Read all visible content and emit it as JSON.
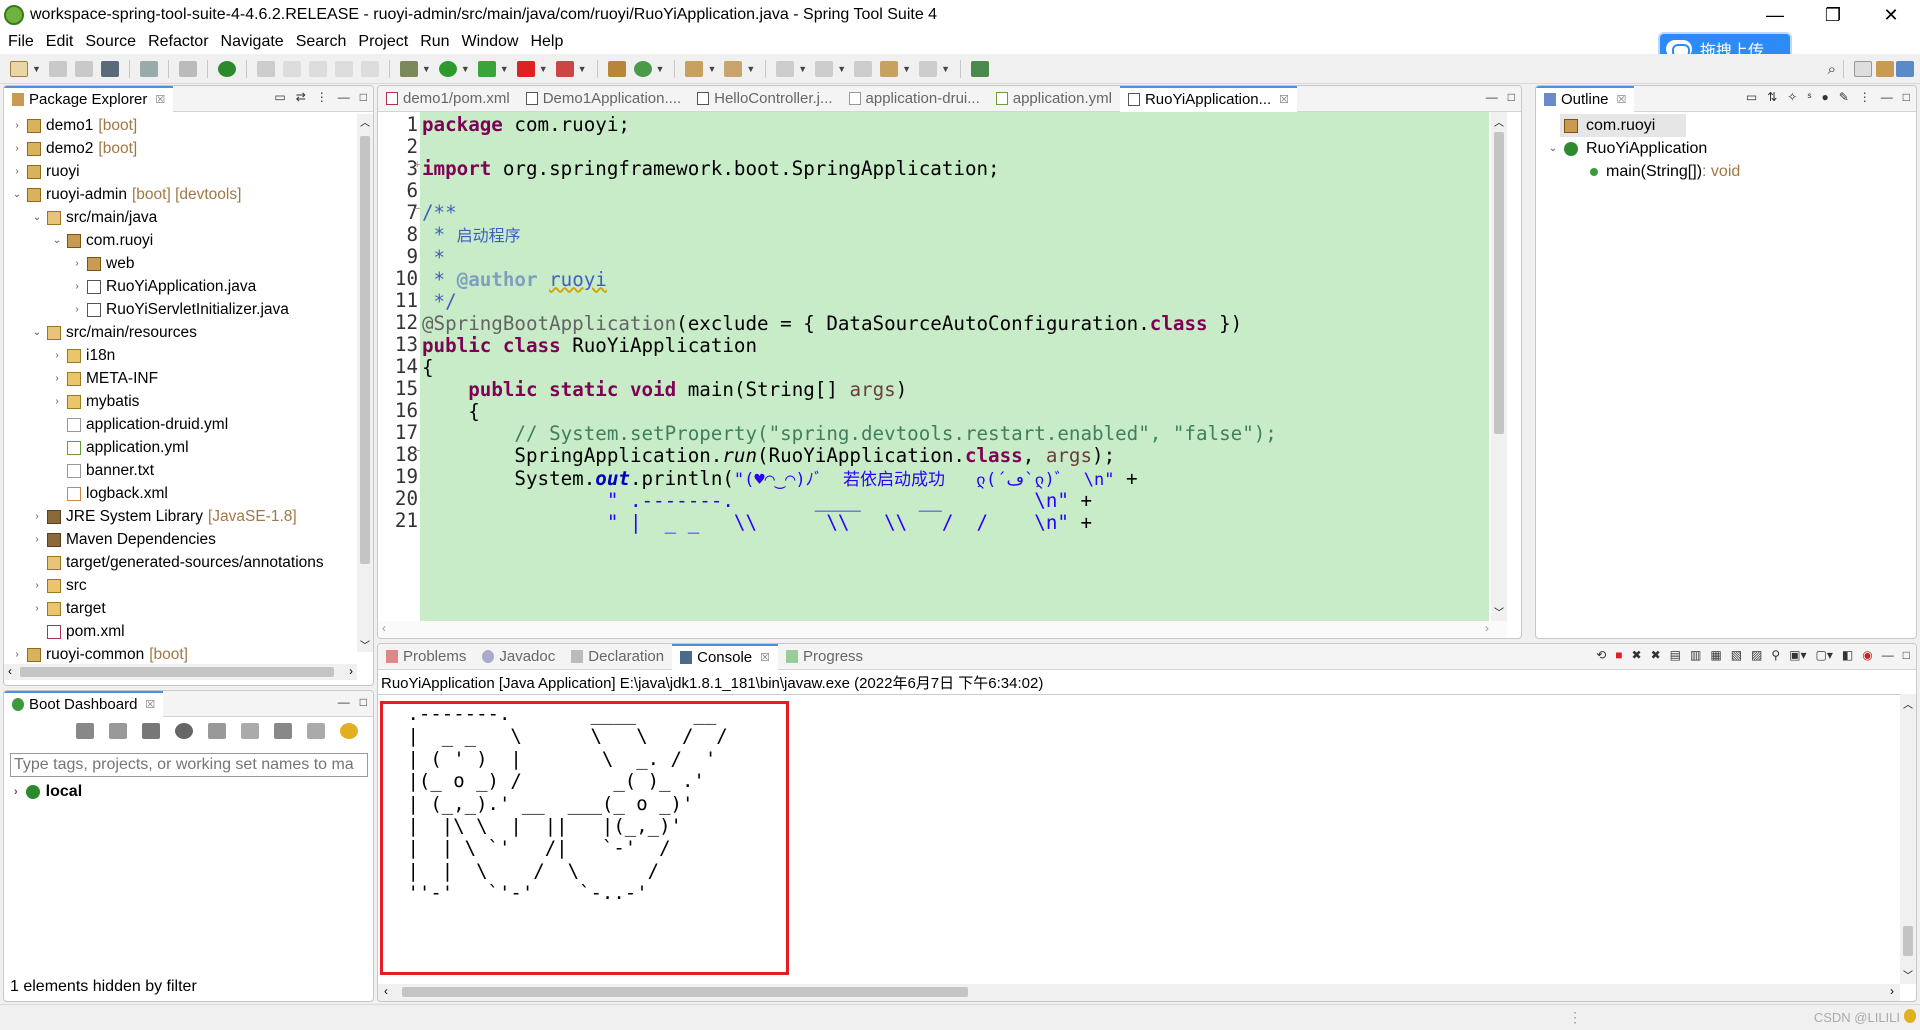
{
  "window": {
    "title": "workspace-spring-tool-suite-4-4.6.2.RELEASE - ruoyi-admin/src/main/java/com/ruoyi/RuoYiApplication.java - Spring Tool Suite 4",
    "minimize": "—",
    "restore": "❐",
    "close": "✕"
  },
  "menu": [
    "File",
    "Edit",
    "Source",
    "Refactor",
    "Navigate",
    "Search",
    "Project",
    "Run",
    "Window",
    "Help"
  ],
  "upload_button": "拖拽上传",
  "package_explorer": {
    "title": "Package Explorer",
    "tree": [
      {
        "label": "demo1",
        "dec": "[boot]",
        "depth": 0,
        "arrow": "›",
        "icon": "proj"
      },
      {
        "label": "demo2",
        "dec": "[boot]",
        "depth": 0,
        "arrow": "›",
        "icon": "proj"
      },
      {
        "label": "ruoyi",
        "dec": "",
        "depth": 0,
        "arrow": "›",
        "icon": "proj"
      },
      {
        "label": "ruoyi-admin",
        "dec": "[boot] [devtools]",
        "depth": 0,
        "arrow": "⌄",
        "icon": "proj"
      },
      {
        "label": "src/main/java",
        "dec": "",
        "depth": 1,
        "arrow": "⌄",
        "icon": "src"
      },
      {
        "label": "com.ruoyi",
        "dec": "",
        "depth": 2,
        "arrow": "⌄",
        "icon": "pkg"
      },
      {
        "label": "web",
        "dec": "",
        "depth": 3,
        "arrow": "›",
        "icon": "pkg"
      },
      {
        "label": "RuoYiApplication.java",
        "dec": "",
        "depth": 3,
        "arrow": "›",
        "icon": "java"
      },
      {
        "label": "RuoYiServletInitializer.java",
        "dec": "",
        "depth": 3,
        "arrow": "›",
        "icon": "java"
      },
      {
        "label": "src/main/resources",
        "dec": "",
        "depth": 1,
        "arrow": "⌄",
        "icon": "src"
      },
      {
        "label": "i18n",
        "dec": "",
        "depth": 2,
        "arrow": "›",
        "icon": "fold"
      },
      {
        "label": "META-INF",
        "dec": "",
        "depth": 2,
        "arrow": "›",
        "icon": "fold"
      },
      {
        "label": "mybatis",
        "dec": "",
        "depth": 2,
        "arrow": "›",
        "icon": "fold"
      },
      {
        "label": "application-druid.yml",
        "dec": "",
        "depth": 2,
        "arrow": "",
        "icon": "file"
      },
      {
        "label": "application.yml",
        "dec": "",
        "depth": 2,
        "arrow": "",
        "icon": "yml"
      },
      {
        "label": "banner.txt",
        "dec": "",
        "depth": 2,
        "arrow": "",
        "icon": "file"
      },
      {
        "label": "logback.xml",
        "dec": "",
        "depth": 2,
        "arrow": "",
        "icon": "xml"
      },
      {
        "label": "JRE System Library",
        "dec": "[JavaSE-1.8]",
        "depth": 1,
        "arrow": "›",
        "icon": "lib"
      },
      {
        "label": "Maven Dependencies",
        "dec": "",
        "depth": 1,
        "arrow": "›",
        "icon": "lib"
      },
      {
        "label": "target/generated-sources/annotations",
        "dec": "",
        "depth": 1,
        "arrow": "",
        "icon": "src"
      },
      {
        "label": "src",
        "dec": "",
        "depth": 1,
        "arrow": "›",
        "icon": "fold"
      },
      {
        "label": "target",
        "dec": "",
        "depth": 1,
        "arrow": "›",
        "icon": "fold"
      },
      {
        "label": "pom.xml",
        "dec": "",
        "depth": 1,
        "arrow": "",
        "icon": "m"
      },
      {
        "label": "ruoyi-common",
        "dec": "[boot]",
        "depth": 0,
        "arrow": "›",
        "icon": "proj"
      }
    ]
  },
  "boot_dashboard": {
    "title": "Boot Dashboard",
    "filter_placeholder": "Type tags, projects, or working set names to ma",
    "local_label": "local",
    "hidden_note": "1 elements hidden by filter"
  },
  "editor": {
    "tabs": [
      "demo1/pom.xml",
      "Demo1Application....",
      "HelloController.j...",
      "application-drui...",
      "application.yml",
      "RuoYiApplication..."
    ],
    "line_numbers": [
      "1",
      "2",
      "3",
      "6",
      "7",
      "8",
      "9",
      "10",
      "11",
      "12",
      "13",
      "14",
      "15",
      "16",
      "17",
      "18",
      "19",
      "20",
      "21"
    ],
    "code": {
      "l1_kw": "package",
      "l1_rest": " com.ruoyi;",
      "l3_kw": "import",
      "l3_rest": " org.springframework.boot.SpringApplication;",
      "l7": "/**",
      "l8_pre": " * ",
      "l8_text": "启动程序",
      "l9": " *",
      "l10_pre": " * ",
      "l10_tag": "@author",
      "l10_sp": " ",
      "l10_name": "ruoyi",
      "l11": " */",
      "l12_ann": "@SpringBootApplication",
      "l12_a": "(exclude = { DataSourceAutoConfiguration.",
      "l12_kw": "class",
      "l12_b": " })",
      "l13_kw1": "public",
      "l13_kw2": "class",
      "l13_rest": " RuoYiApplication",
      "l14": "{",
      "l15_ind": "    ",
      "l15_kw1": "public",
      "l15_kw2": "static",
      "l15_kw3": "void",
      "l15_a": " main(String[] ",
      "l15_par": "args",
      "l15_b": ")",
      "l16": "    {",
      "l17_ind": "        ",
      "l17_cm": "// System.setProperty(\"spring.devtools.restart.enabled\", \"false\");",
      "l18_ind": "        ",
      "l18_a": "SpringApplication.",
      "l18_run": "run",
      "l18_b": "(RuoYiApplication.",
      "l18_kw": "class",
      "l18_c": ", ",
      "l18_par": "args",
      "l18_d": ");",
      "l19_ind": "        ",
      "l19_a": "System.",
      "l19_out": "out",
      "l19_b": ".println(",
      "l19_st": "\"(♥◠‿◠)ﾉﾞ  若依启动成功   ლ(´ڡ`ლ)ﾞ  \\n\"",
      "l19_c": " +",
      "l20_ind": "                ",
      "l20_st": "\" .-------.       ____     __        \\n\"",
      "l20_c": " +",
      "l21_ind": "                ",
      "l21_st": "\" |  _ _   \\\\      \\\\   \\\\   /  /    \\n\"",
      "l21_c": " +"
    }
  },
  "outline": {
    "title": "Outline",
    "items": [
      "com.ruoyi",
      "RuoYiApplication",
      "main(String[])"
    ],
    "main_return": " : void"
  },
  "console": {
    "tabs": [
      "Problems",
      "Javadoc",
      "Declaration",
      "Console",
      "Progress"
    ],
    "launch": "RuoYiApplication [Java Application] E:\\java\\jdk1.8.1_181\\bin\\javaw.exe  (2022年6月7日 下午6:34:02)",
    "output": " .-------.       ____     __\n |  _ _   \\      \\   \\   /  /\n | ( ' )  |       \\  _. /  '\n |(_ o _) /        _( )_ .'\n | (_,_).' __  ___(_ o _)'\n |  |\\ \\  |  ||   |(_,_)'\n |  | \\ `'   /|   `-'  /\n |  |  \\    /  \\      /\n ''-'   `'-'    `-..-'"
  },
  "status": {
    "watermark": "CSDN @LILILI"
  },
  "colors": {
    "editor_bg": "#c8ecc8",
    "keyword": "#7f0055",
    "string": "#2a00ff",
    "comment": "#3f7f5f",
    "highlight_box": "#e51e25",
    "active_tab": "#4a90e2"
  }
}
